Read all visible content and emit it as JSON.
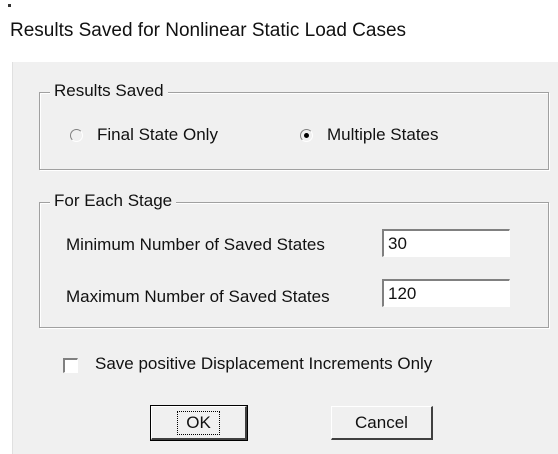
{
  "window": {
    "title": "Results Saved for Nonlinear Static Load Cases"
  },
  "results_saved": {
    "legend": "Results Saved",
    "options": [
      {
        "label": "Final State Only",
        "selected": false
      },
      {
        "label": "Multiple States",
        "selected": true
      }
    ]
  },
  "each_stage": {
    "legend": "For Each Stage",
    "min_label": "Minimum Number of Saved States",
    "min_value": "30",
    "max_label": "Maximum Number of Saved States",
    "max_value": "120"
  },
  "checkbox": {
    "label": "Save positive Displacement Increments Only",
    "checked": false
  },
  "buttons": {
    "ok": "OK",
    "cancel": "Cancel"
  }
}
